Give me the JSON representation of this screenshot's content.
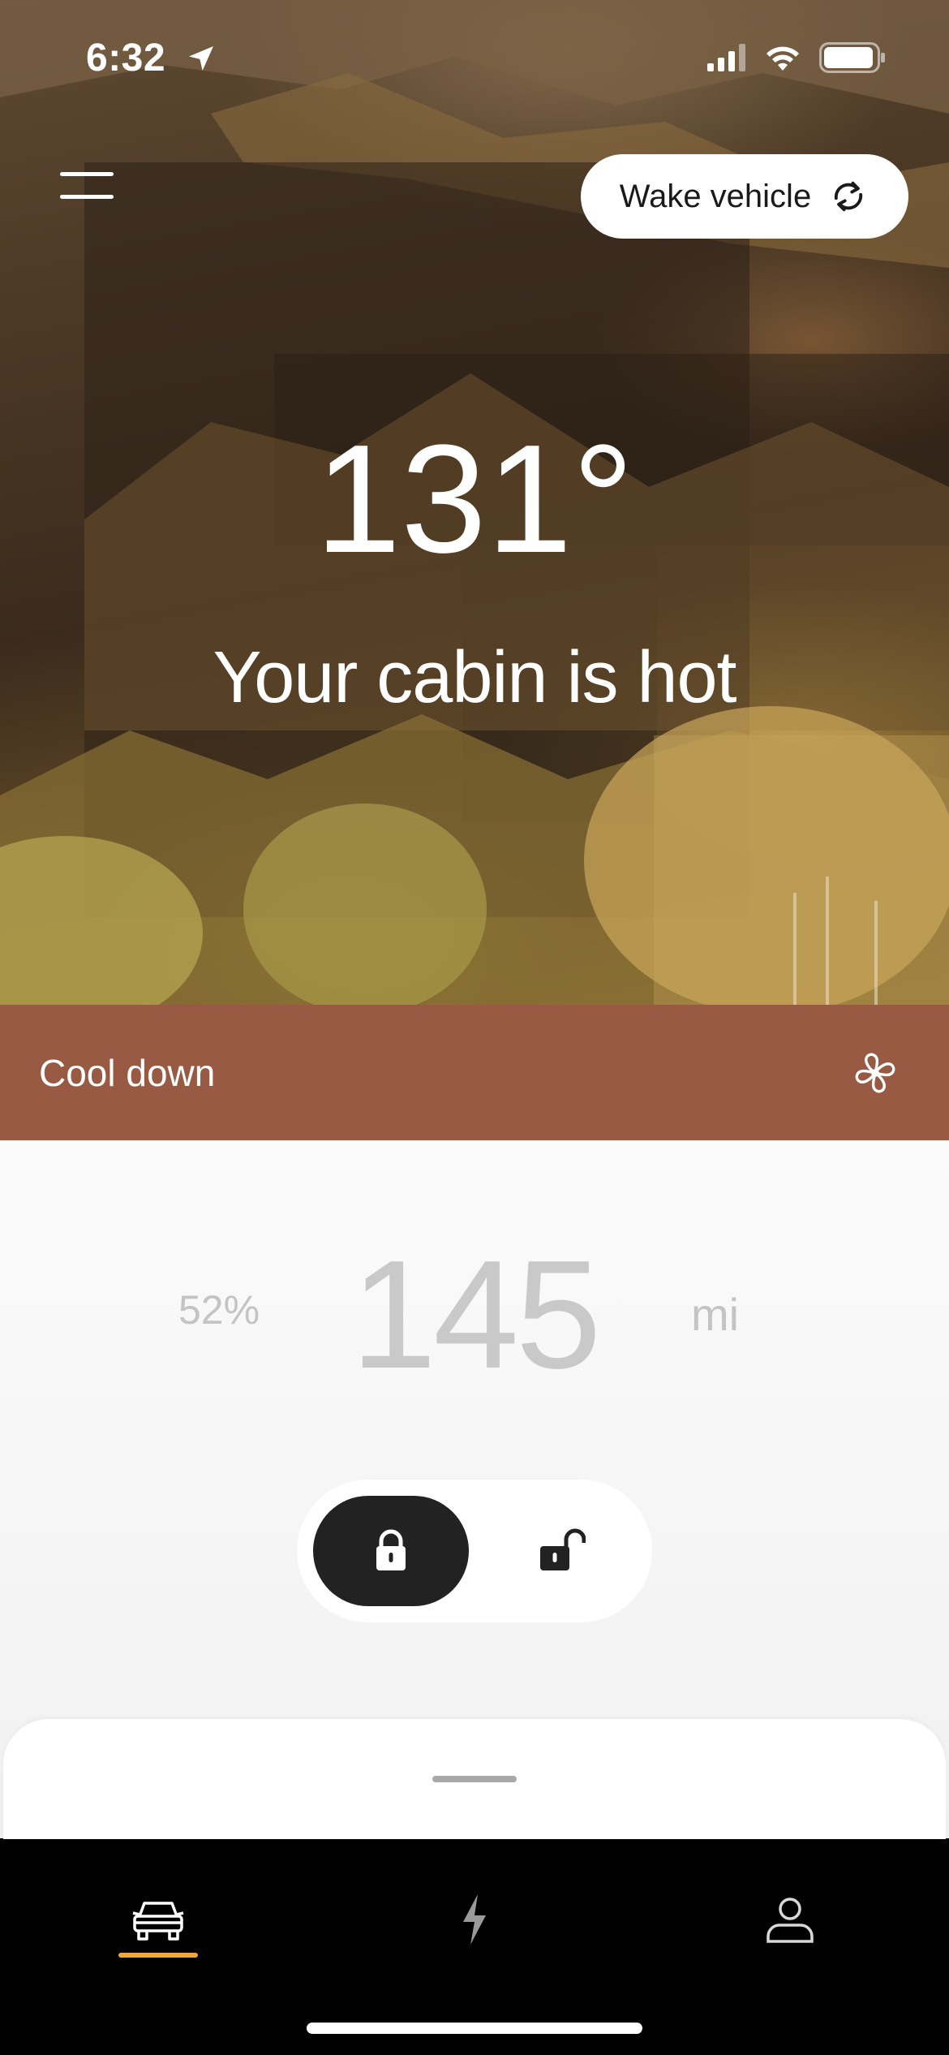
{
  "status_bar": {
    "time": "6:32",
    "icons": [
      "location-arrow-icon",
      "cellular-signal-icon",
      "wifi-icon",
      "battery-icon"
    ]
  },
  "header": {
    "menu_icon": "hamburger-menu-icon",
    "wake_label": "Wake vehicle",
    "wake_icon": "refresh-icon"
  },
  "cabin": {
    "temperature": "131°",
    "message": "Your cabin is hot"
  },
  "climate": {
    "action_label": "Cool down",
    "icon": "fan-icon",
    "bar_color": "#985a43"
  },
  "range": {
    "battery_percent": "52%",
    "value": "145",
    "unit": "mi"
  },
  "lock_control": {
    "lock_icon": "lock-icon",
    "unlock_icon": "unlock-icon",
    "selected": "lock"
  },
  "tab_bar": {
    "tabs": [
      {
        "icon": "car-icon",
        "active": true
      },
      {
        "icon": "lightning-icon",
        "active": false
      },
      {
        "icon": "profile-icon",
        "active": false
      }
    ],
    "active_color": "#f0a73a"
  }
}
